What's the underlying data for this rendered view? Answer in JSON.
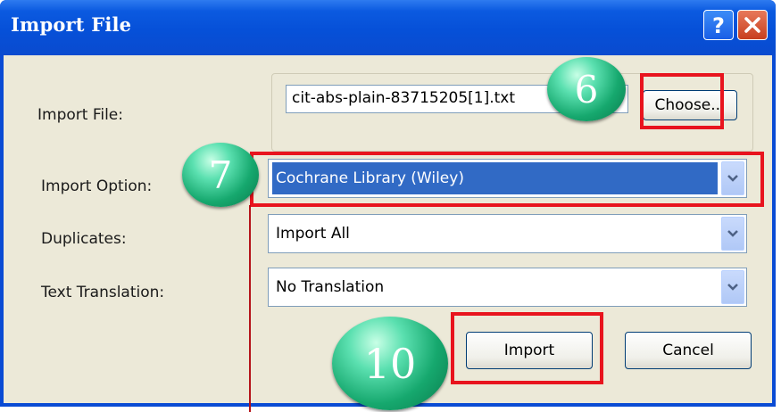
{
  "window": {
    "title": "Import File"
  },
  "title_buttons": {
    "help_icon": "question-mark",
    "close_icon": "x"
  },
  "form": {
    "import_file_label": "Import File:",
    "import_file_value": "cit-abs-plain-83715205[1].txt",
    "choose_label": "Choose...",
    "import_option_label": "Import Option:",
    "import_option_value": "Cochrane Library (Wiley)",
    "duplicates_label": "Duplicates:",
    "duplicates_value": "Import All",
    "text_translation_label": "Text Translation:",
    "text_translation_value": "No Translation"
  },
  "actions": {
    "import_label": "Import",
    "cancel_label": "Cancel"
  },
  "callouts": {
    "step_6": "6",
    "step_7": "7",
    "step_10": "10"
  },
  "colors": {
    "titlebar": "#0a4bd4",
    "dialog_bg": "#ece9d8",
    "selection": "#316ac5",
    "highlight_box": "#e8141e",
    "callout": "#16a86e"
  }
}
